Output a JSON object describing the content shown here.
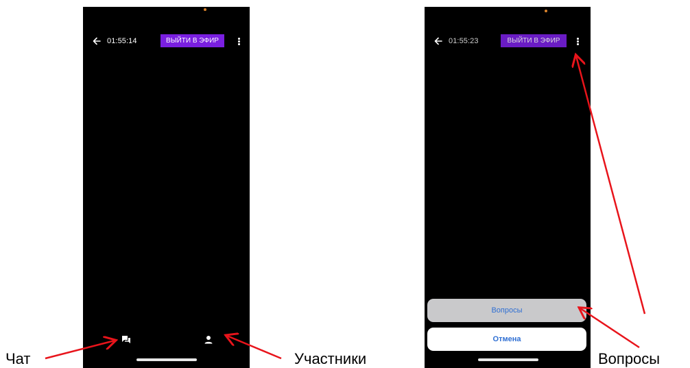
{
  "left_screen": {
    "timer": "01:55:14",
    "live_button": "ВЫЙТИ В ЭФИР"
  },
  "right_screen": {
    "timer": "01:55:23",
    "live_button": "ВЫЙТИ В ЭФИР",
    "action_sheet": {
      "questions": "Вопросы",
      "cancel": "Отмена"
    }
  },
  "annotations": {
    "chat": "Чат",
    "participants": "Участники",
    "questions": "Вопросы"
  },
  "icons": {
    "back": "arrow-left-icon",
    "more": "more-vertical-icon",
    "chat": "chat-icon",
    "participants": "person-icon"
  },
  "colors": {
    "live_button": "#7a1fe0",
    "annotation_arrow": "#e8141b",
    "sheet_text": "#2f6fd3"
  }
}
